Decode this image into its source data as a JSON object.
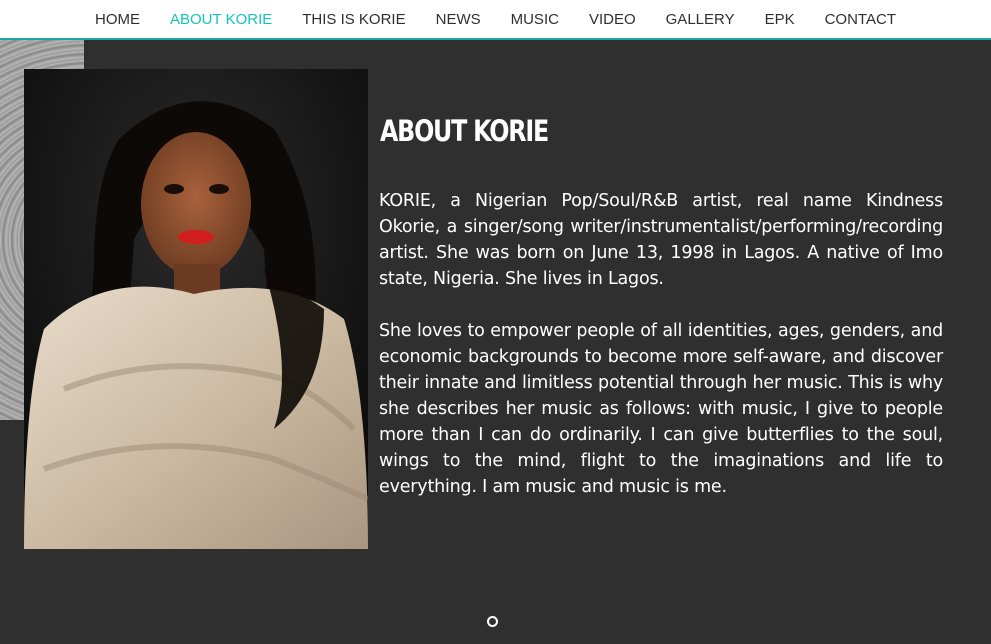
{
  "nav": {
    "items": [
      {
        "label": "HOME"
      },
      {
        "label": "ABOUT KORIE",
        "active": true
      },
      {
        "label": "THIS IS KORIE"
      },
      {
        "label": "NEWS"
      },
      {
        "label": "MUSIC"
      },
      {
        "label": "VIDEO"
      },
      {
        "label": "GALLERY"
      },
      {
        "label": "EPK"
      },
      {
        "label": "CONTACT"
      }
    ],
    "accent_color": "#14c4bb"
  },
  "about": {
    "title": "ABOUT KORIE",
    "paragraphs": [
      "KORIE, a Nigerian Pop/Soul/R&B artist, real name Kindness Okorie, a singer/song writer/instrumentalist/performing/recording artist. She was born on June 13, 1998 in Lagos. A native of Imo state, Nigeria. She lives in Lagos.",
      "She loves to empower people of all identities, ages, genders, and economic backgrounds to become more self-aware, and discover their innate and limitless potential through her music. This is why she describes her music as follows: with music, I give to people more than I can do ordinarily. I can give butterflies to the soul, wings to the mind, flight to the imaginations and life to everything. I am music and music is me."
    ]
  },
  "colors": {
    "background": "#2f2f2f",
    "text": "#ffffff"
  }
}
